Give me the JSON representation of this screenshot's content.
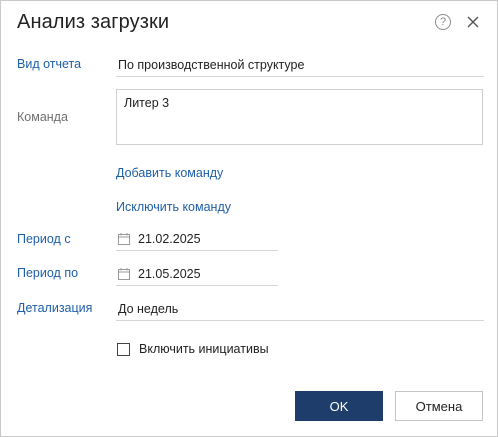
{
  "dialog": {
    "title": "Анализ загрузки",
    "help_symbol": "?"
  },
  "form": {
    "report_type": {
      "label": "Вид отчета",
      "value": "По производственной структуре"
    },
    "team": {
      "label": "Команда",
      "value": "Литер 3",
      "add_link": "Добавить команду",
      "remove_link": "Исключить команду"
    },
    "period_from": {
      "label": "Период с",
      "value": "21.02.2025"
    },
    "period_to": {
      "label": "Период по",
      "value": "21.05.2025"
    },
    "detail": {
      "label": "Детализация",
      "value": "До недель"
    },
    "initiatives": {
      "label": "Включить инициативы",
      "checked": false
    }
  },
  "buttons": {
    "ok": "OK",
    "cancel": "Отмена"
  },
  "colors": {
    "link": "#1f5fa8",
    "primary_button": "#1f3d6b"
  }
}
